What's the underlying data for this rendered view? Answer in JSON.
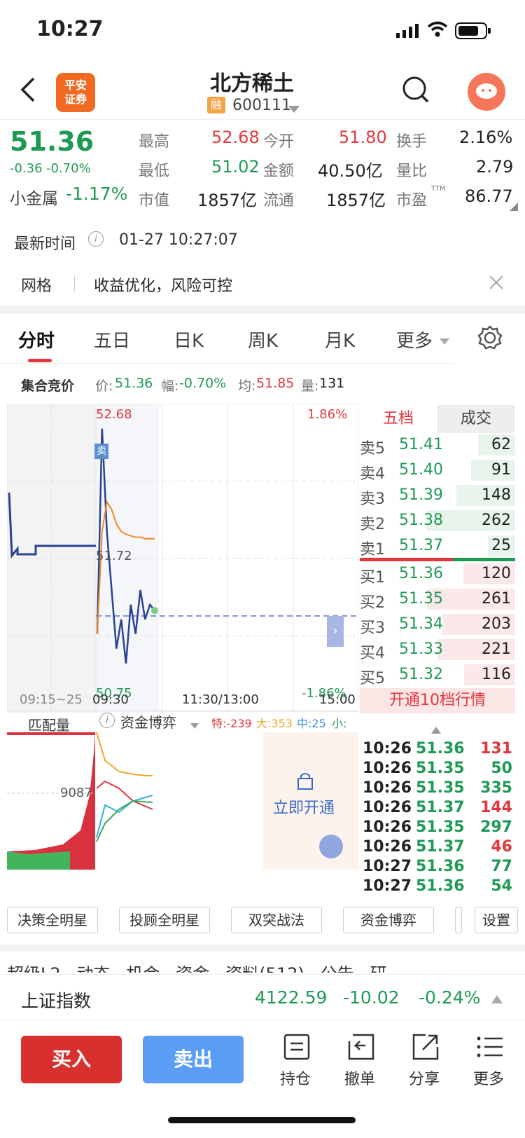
{
  "status": {
    "time": "10:27"
  },
  "header": {
    "title": "北方稀土",
    "rong": "融",
    "code": "600111",
    "logo": "平安\n证券"
  },
  "quote": {
    "price": "51.36",
    "change": "-0.36",
    "change_pct": "-0.70%",
    "sector_label": "小金属",
    "sector_change": "-1.17%",
    "high_label": "最高",
    "high": "52.68",
    "open_label": "今开",
    "open": "51.80",
    "turnover_label": "换手",
    "turnover": "2.16%",
    "low_label": "最低",
    "low": "51.02",
    "amount_label": "金额",
    "amount": "40.50亿",
    "volratio_label": "量比",
    "volratio": "2.79",
    "mcap_label": "市值",
    "mcap": "1857亿",
    "float_label": "流通",
    "float": "1857亿",
    "pe_label": "市盈",
    "pe_sup": "TTM",
    "pe": "86.77"
  },
  "update": {
    "label": "最新时间",
    "time": "01-27 10:27:07"
  },
  "banner": {
    "tag": "网格",
    "text": "收益优化，风险可控"
  },
  "tabs": [
    "分时",
    "五日",
    "日K",
    "周K",
    "月K",
    "更多"
  ],
  "auction": {
    "label": "集合竞价",
    "price_label": "价:",
    "price": "51.36",
    "range_label": "幅:",
    "range": "-0.70%",
    "avg_label": "均:",
    "avg": "51.85",
    "vol_label": "量:",
    "vol": "131"
  },
  "chart": {
    "top_price": "52.68",
    "mid_price": "51.72",
    "bottom_price": "50.75",
    "top_pct": "1.86%",
    "bottom_pct": "-1.86%",
    "sell_tag": "卖",
    "x_labels": [
      "09:15~25",
      "09:30",
      "11:30/13:00",
      "15:00"
    ]
  },
  "chart_data": {
    "type": "line",
    "ylim": [
      50.75,
      52.68
    ],
    "x": [
      "09:30",
      "09:35",
      "09:40",
      "09:45",
      "09:50",
      "09:55",
      "10:00",
      "10:05",
      "10:10",
      "10:15",
      "10:20",
      "10:25",
      "10:27"
    ],
    "series": [
      {
        "values": [
          51.2,
          52.6,
          51.9,
          51.5,
          51.1,
          51.3,
          51.0,
          51.4,
          51.2,
          51.5,
          51.3,
          51.4,
          51.36
        ]
      },
      {
        "values": [
          51.2,
          51.9,
          52.1,
          52.05,
          51.95,
          51.9,
          51.88,
          51.87,
          51.86,
          51.86,
          51.85,
          51.85,
          51.85
        ]
      }
    ]
  },
  "subchart": {
    "label": "匹配量",
    "value": "9087",
    "tab": "资金博弈",
    "te": "特:-239",
    "da": "大:353",
    "zhong": "中:25",
    "xiao": "小:",
    "unlock": "立即开通"
  },
  "orderbook": {
    "tab1": "五档",
    "tab2": "成交",
    "sells": [
      {
        "label": "卖5",
        "price": "51.41",
        "vol": "62"
      },
      {
        "label": "卖4",
        "price": "51.40",
        "vol": "91"
      },
      {
        "label": "卖3",
        "price": "51.39",
        "vol": "148"
      },
      {
        "label": "卖2",
        "price": "51.38",
        "vol": "262"
      },
      {
        "label": "卖1",
        "price": "51.37",
        "vol": "25"
      }
    ],
    "buys": [
      {
        "label": "买1",
        "price": "51.36",
        "vol": "120"
      },
      {
        "label": "买2",
        "price": "51.35",
        "vol": "261"
      },
      {
        "label": "买3",
        "price": "51.34",
        "vol": "203"
      },
      {
        "label": "买4",
        "price": "51.33",
        "vol": "221"
      },
      {
        "label": "买5",
        "price": "51.32",
        "vol": "116"
      }
    ],
    "open10": "开通10档行情"
  },
  "trades": [
    {
      "t": "10:26",
      "p": "51.36",
      "v": "131",
      "c": "red"
    },
    {
      "t": "10:26",
      "p": "51.35",
      "v": "50",
      "c": "green"
    },
    {
      "t": "10:26",
      "p": "51.35",
      "v": "335",
      "c": "green"
    },
    {
      "t": "10:26",
      "p": "51.37",
      "v": "144",
      "c": "red"
    },
    {
      "t": "10:26",
      "p": "51.35",
      "v": "297",
      "c": "green"
    },
    {
      "t": "10:26",
      "p": "51.37",
      "v": "46",
      "c": "red"
    },
    {
      "t": "10:27",
      "p": "51.36",
      "v": "77",
      "c": "green"
    },
    {
      "t": "10:27",
      "p": "51.36",
      "v": "54",
      "c": "green"
    }
  ],
  "tools": [
    "决策全明星",
    "投顾全明星",
    "双突战法",
    "资金博弈",
    "设置"
  ],
  "subtabs": "超级L2   动态   机会   资金   资料(512)   公告   研",
  "index": {
    "name": "上证指数",
    "value": "4122.59",
    "change": "-10.02",
    "pct": "-0.24%"
  },
  "bottom": {
    "buy": "买入",
    "sell": "卖出",
    "hold": "持仓",
    "cancel": "撤单",
    "share": "分享",
    "more": "更多"
  },
  "colors": {
    "red": "#e0383e",
    "green": "#1f9a55",
    "blue": "#5b9cf5"
  }
}
